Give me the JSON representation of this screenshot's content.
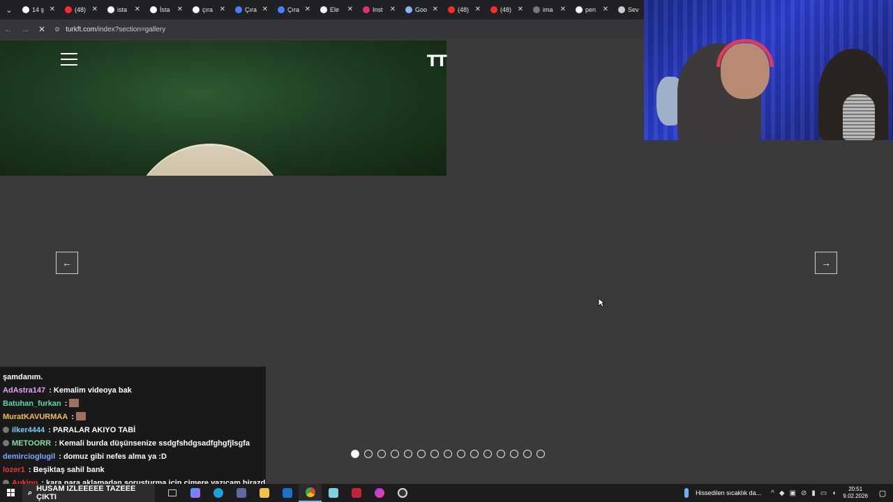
{
  "browser": {
    "tabs": [
      {
        "label": "14 ş",
        "color": "#ffffff"
      },
      {
        "label": "(48)",
        "color": "#ff2a2a"
      },
      {
        "label": "ista",
        "color": "#ffffff"
      },
      {
        "label": "İsta",
        "color": "#ffffff"
      },
      {
        "label": "çıra",
        "color": "#ffffff"
      },
      {
        "label": "Çıra",
        "color": "#4a7dff"
      },
      {
        "label": "Çıra",
        "color": "#4a7dff"
      },
      {
        "label": "Ele",
        "color": "#ffffff"
      },
      {
        "label": "Inst",
        "color": "#e1306c"
      },
      {
        "label": "Goo",
        "color": "#8ab4f8"
      },
      {
        "label": "(48)",
        "color": "#ff2a2a"
      },
      {
        "label": "(48)",
        "color": "#ff2a2a"
      },
      {
        "label": "ima",
        "color": "#777777"
      },
      {
        "label": "pen",
        "color": "#ffffff"
      },
      {
        "label": "Sev",
        "color": "#cccccc"
      }
    ],
    "url_domain": "turkft.com",
    "url_path": "/index?section=gallery"
  },
  "page": {
    "logo": "TT",
    "prev_arrow": "←",
    "next_arrow": "→",
    "slide_count": 15,
    "active_slide": 1
  },
  "chat": {
    "messages": [
      {
        "user": "AdAstra147",
        "color": "#e8a0ff",
        "text": " : Kemalim videoya bak",
        "badge": false,
        "emote": false
      },
      {
        "user": "Batuhan_furkan",
        "color": "#57d6b4",
        "text": " :",
        "badge": false,
        "emote": true
      },
      {
        "user": "MuratKAVURMAA",
        "color": "#f0c050",
        "text": " :",
        "badge": false,
        "emote": true
      },
      {
        "user": "ilker4444",
        "color": "#6ed0ff",
        "text": " : PARALAR AKIYO TABİ",
        "badge": true,
        "emote": false
      },
      {
        "user": "METOORR",
        "color": "#7fe09a",
        "text": " : Kemali burda düşünsenize ssdgfshdgsadfghgfjlsgfa",
        "badge": true,
        "emote": false
      },
      {
        "user": "demircioglugil",
        "color": "#7aa8ff",
        "text": " : domuz gibi nefes alma ya :D",
        "badge": false,
        "emote": false
      },
      {
        "user": "lozer1",
        "color": "#e23a3a",
        "text": " : Beşiktaş sahil bank",
        "badge": false,
        "emote": false
      },
      {
        "user": "Aukino",
        "color": "#ff3030",
        "text": " : kara para aklamadan soruşturma için cimere yazıcam birazdan",
        "badge": true,
        "emote": false
      }
    ],
    "partial_top": "şamdanım."
  },
  "taskbar": {
    "search_text": "HUSAM IZLEEEEE TAZEEE ÇIKTI",
    "weather_text": "Hissedilen sıcaklık da...",
    "time": "20:51",
    "date": "9.02.2026"
  }
}
